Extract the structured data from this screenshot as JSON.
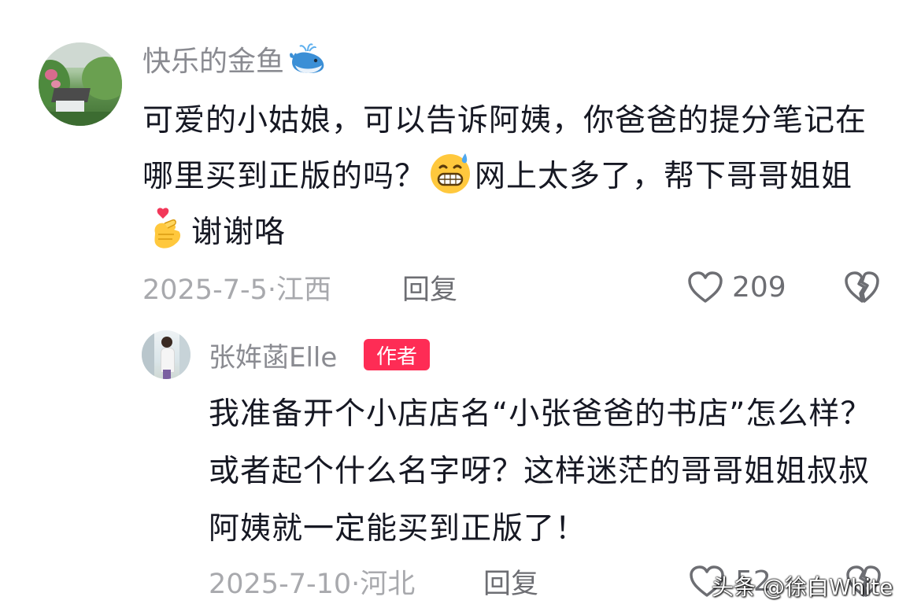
{
  "comments": [
    {
      "username": "快乐的金鱼",
      "username_emoji": "whale-emoji",
      "body_segments": [
        "可爱的小姑娘，可以告诉阿姨，你爸爸的提分笔记在哪里买到正版的吗？",
        "网上太多了，帮下哥哥姐姐",
        "谢谢咯"
      ],
      "inline_emojis": [
        "grinning-sweat-emoji",
        "finger-heart-emoji"
      ],
      "date_location": "2025-7-5·江西",
      "reply_label": "回复",
      "like_count": "209"
    },
    {
      "username": "张姩菡Elle",
      "badge": "作者",
      "body": "我准备开个小店店名“小张爸爸的书店”怎么样？或者起个什么名字呀？这样迷茫的哥哥姐姐叔叔阿姨就一定能买到正版了！",
      "date_location": "2025-7-10·河北",
      "reply_label": "回复",
      "like_count": "52"
    }
  ],
  "watermark": "头条 @徐白White",
  "colors": {
    "text_primary": "#161823",
    "text_secondary": "#8a8b91",
    "text_meta": "#a8a9ad",
    "badge_bg": "#fe2c55"
  }
}
